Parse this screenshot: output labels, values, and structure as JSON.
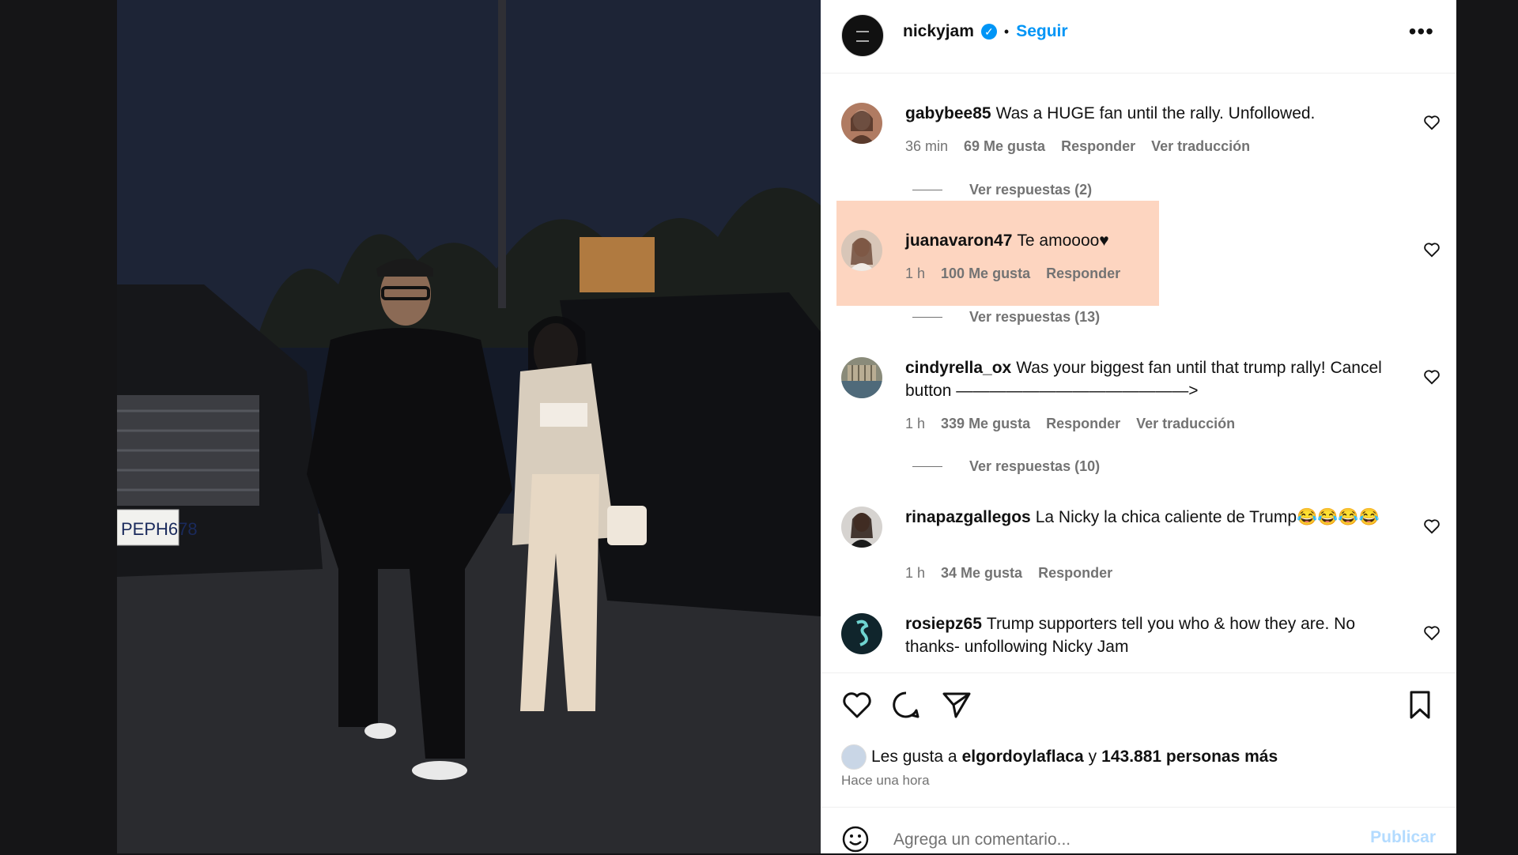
{
  "post": {
    "author": "nickyjam",
    "separator": "•",
    "follow_label": "Seguir",
    "more_label": "•••"
  },
  "comments": [
    {
      "user": "gabybee85",
      "text": "Was a HUGE fan until the rally. Unfollowed.",
      "time": "36 min",
      "likes": "69 Me gusta",
      "reply": "Responder",
      "translate": "Ver traducción",
      "replies": "Ver respuestas (2)"
    },
    {
      "user": "juanavaron47",
      "text": "Te amoooo♥",
      "time": "1 h",
      "likes": "100 Me gusta",
      "reply": "Responder",
      "replies": "Ver respuestas (13)"
    },
    {
      "user": "cindyrella_ox",
      "text": "Was your biggest fan until that trump rally! Cancel button ——————————————>",
      "time": "1 h",
      "likes": "339 Me gusta",
      "reply": "Responder",
      "translate": "Ver traducción",
      "replies": "Ver respuestas (10)"
    },
    {
      "user": "rinapazgallegos",
      "text": "La Nicky la chica caliente de Trump😂😂😂😂",
      "time": "1 h",
      "likes": "34 Me gusta",
      "reply": "Responder"
    },
    {
      "user": "rosiepz65",
      "text": "Trump supporters tell you who & how they are. No thanks- unfollowing Nicky Jam"
    }
  ],
  "likes": {
    "prefix": "Les gusta a",
    "user": "elgordoylaflaca",
    "and": "y",
    "count": "143.881 personas más"
  },
  "time_ago": "Hace una hora",
  "add_comment": {
    "placeholder": "Agrega un comentario...",
    "publish_label": "Publicar"
  },
  "photo": {
    "plate": "PEPH678"
  },
  "colors": {
    "accent": "#0095f6",
    "highlight": "#fdd5c0"
  }
}
